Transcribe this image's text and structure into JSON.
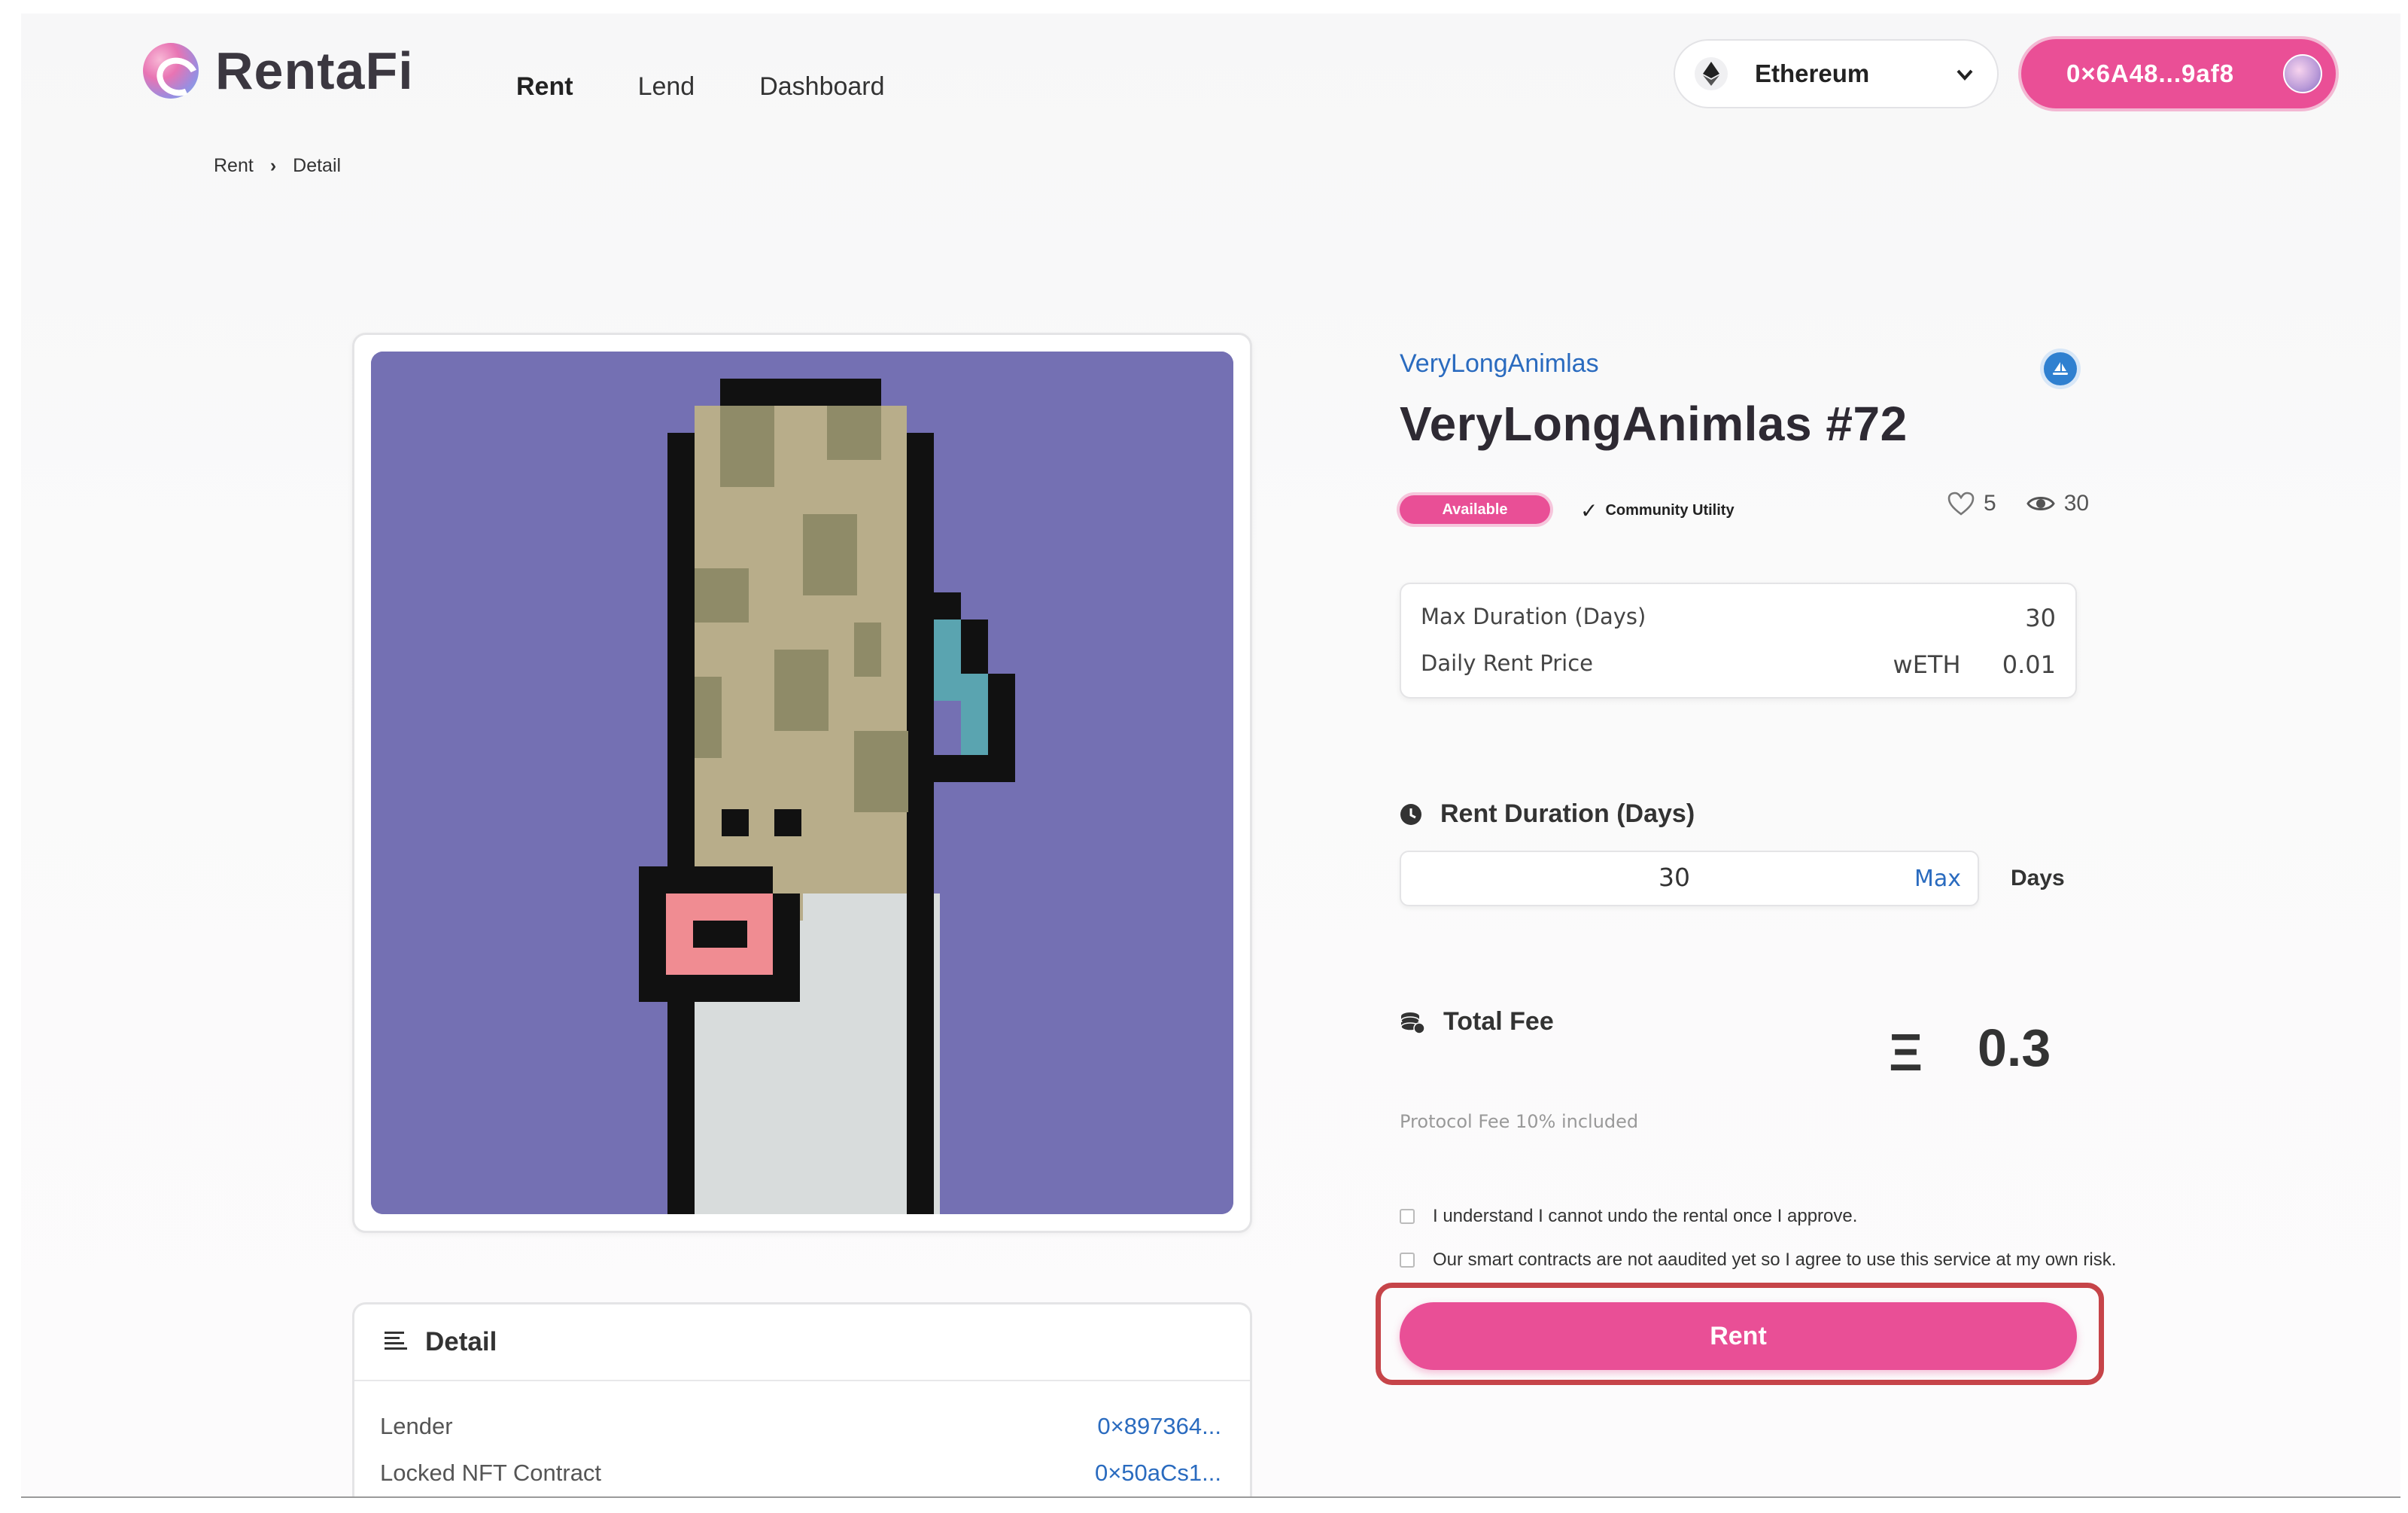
{
  "brand": {
    "name": "RentaFi"
  },
  "nav": {
    "items": [
      {
        "label": "Rent"
      },
      {
        "label": "Lend"
      },
      {
        "label": "Dashboard"
      }
    ]
  },
  "chain": {
    "label": "Ethereum"
  },
  "wallet": {
    "address": "0×6A48...9af8"
  },
  "breadcrumb": {
    "items": [
      "Rent",
      "Detail"
    ],
    "separator": "›"
  },
  "nft": {
    "collection": "VeryLongAnimlas",
    "title": "VeryLongAnimlas #72",
    "status": "Available",
    "utility": "Community Utility",
    "likes": "5",
    "views": "30"
  },
  "terms": {
    "max_duration_label": "Max Duration (Days)",
    "max_duration_value": "30",
    "daily_price_label": "Daily Rent Price",
    "daily_price_currency": "wETH",
    "daily_price_value": "0.01"
  },
  "duration": {
    "label": "Rent Duration (Days)",
    "value": "30",
    "max_label": "Max",
    "unit": "Days"
  },
  "fee": {
    "label": "Total Fee",
    "symbol": "Ξ",
    "value": "0.3",
    "protocol_note": "Protocol Fee 10% included"
  },
  "agreements": [
    "I understand I cannot undo the rental once I approve.",
    "Our smart contracts are not aaudited yet so I agree to use this service at my own risk."
  ],
  "action": {
    "rent_label": "Rent"
  },
  "detail": {
    "title": "Detail",
    "rows": [
      {
        "key": "Lender",
        "value": "0×897364..."
      },
      {
        "key": "Locked NFT Contract",
        "value": "0×50aCs1..."
      }
    ]
  },
  "colors": {
    "accent": "#e94f96",
    "link": "#2a6bbf",
    "art_background": "#7470b3",
    "highlight": "#c64449"
  }
}
